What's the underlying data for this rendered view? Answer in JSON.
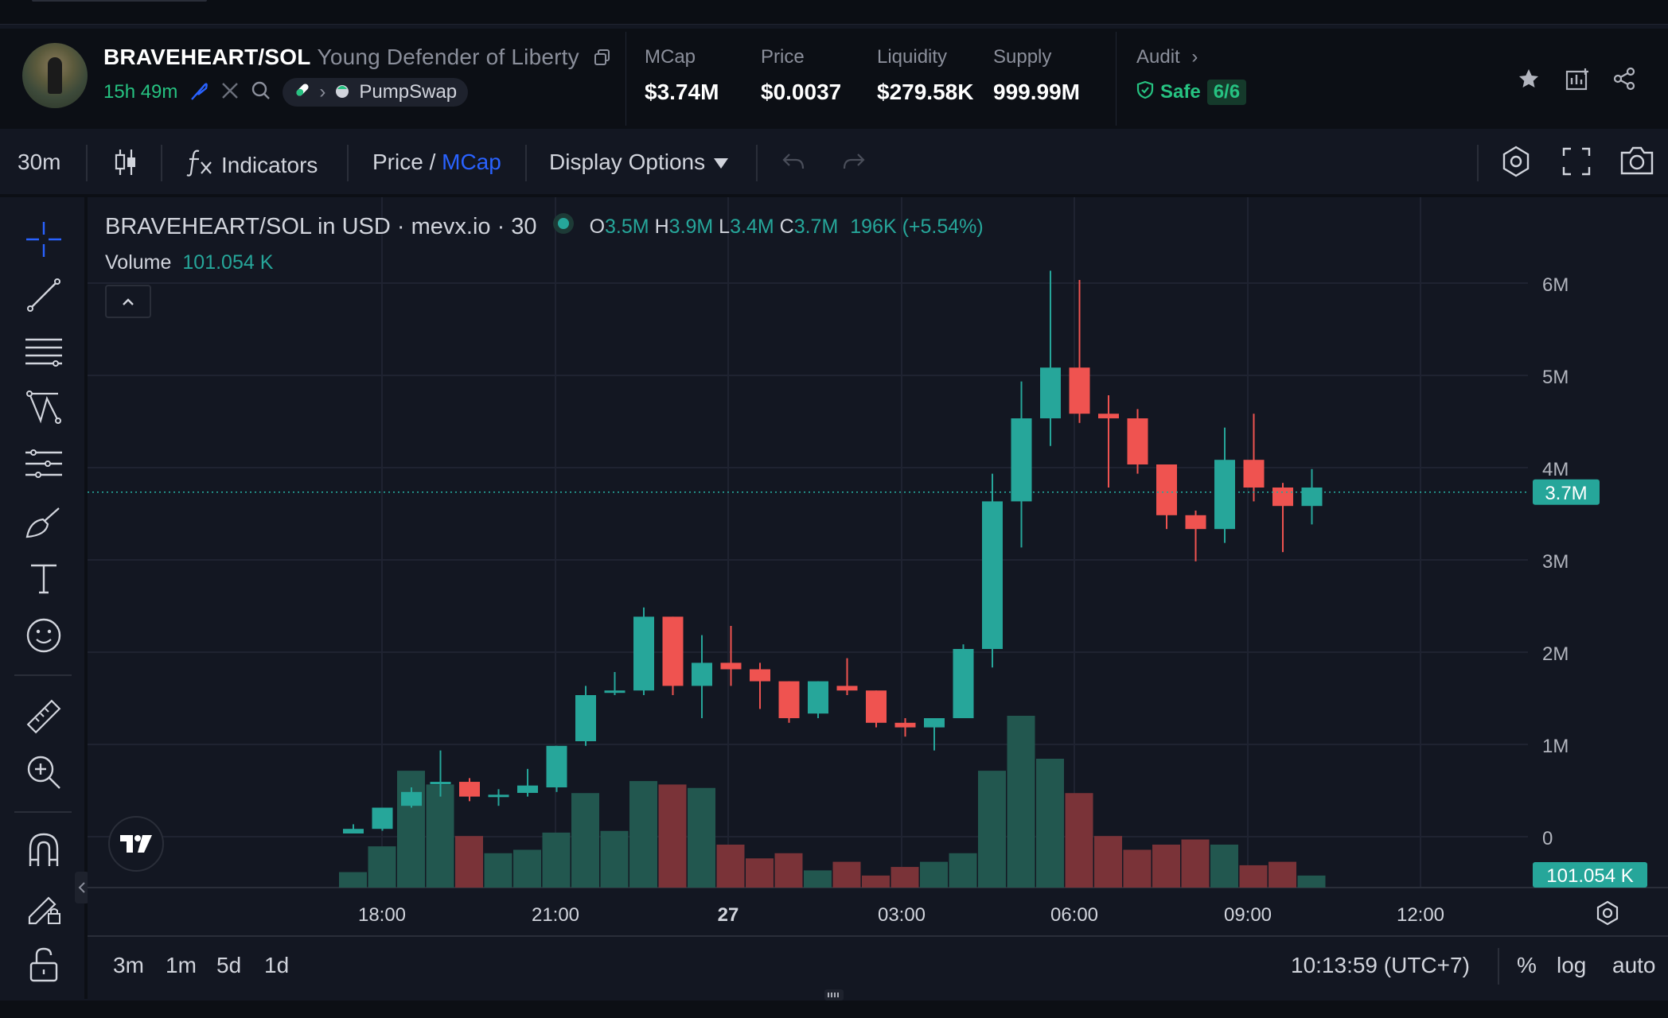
{
  "header": {
    "pair": "BRAVEHEART/SOL",
    "name": "Young Defender of Liberty",
    "age": "15h 49m",
    "dex": "PumpSwap",
    "stats": [
      {
        "label": "MCap",
        "value": "$3.74M"
      },
      {
        "label": "Price",
        "value": "$0.0037"
      },
      {
        "label": "Liquidity",
        "value": "$279.58K"
      },
      {
        "label": "Supply",
        "value": "999.99M"
      }
    ],
    "audit": {
      "label": "Audit",
      "status": "Safe",
      "score": "6/6"
    }
  },
  "toolbar": {
    "interval": "30m",
    "indicators": "Indicators",
    "price_label": "Price",
    "slash": " / ",
    "mcap_label": "MCap",
    "display_options": "Display Options"
  },
  "legend": {
    "title": "BRAVEHEART/SOL in USD · mevx.io · 30",
    "o_label": "O",
    "o": "3.5M",
    "h_label": "H",
    "h": "3.9M",
    "l_label": "L",
    "l": "3.4M",
    "c_label": "C",
    "c": "3.7M",
    "change": "196K (+5.54%)",
    "volume_label": "Volume",
    "volume_value": "101.054 K"
  },
  "chart_data": {
    "type": "candlestick",
    "price_axis_ticks": [
      "6M",
      "5M",
      "4M",
      "3M",
      "2M",
      "1M",
      "0"
    ],
    "time_axis_ticks": [
      "18:00",
      "21:00",
      "27",
      "03:00",
      "06:00",
      "09:00",
      "12:00"
    ],
    "ylim": [
      0,
      6000000
    ],
    "last_price_label": "3.7M",
    "last_price": 3700000,
    "last_volume_label": "101.054 K",
    "candles": [
      {
        "o": 0.0,
        "h": 0.1,
        "l": 0.0,
        "c": 0.05,
        "v": 0.09
      },
      {
        "o": 0.05,
        "h": 0.28,
        "l": 0.03,
        "c": 0.28,
        "v": 0.24
      },
      {
        "o": 0.3,
        "h": 0.5,
        "l": 0.28,
        "c": 0.45,
        "v": 0.68
      },
      {
        "o": 0.56,
        "h": 0.9,
        "l": 0.4,
        "c": 0.56,
        "v": 0.6
      },
      {
        "o": 0.56,
        "h": 0.6,
        "l": 0.35,
        "c": 0.4,
        "v": 0.3
      },
      {
        "o": 0.42,
        "h": 0.48,
        "l": 0.3,
        "c": 0.42,
        "v": 0.2
      },
      {
        "o": 0.44,
        "h": 0.7,
        "l": 0.4,
        "c": 0.52,
        "v": 0.22
      },
      {
        "o": 0.5,
        "h": 0.95,
        "l": 0.45,
        "c": 0.95,
        "v": 0.32
      },
      {
        "o": 1.0,
        "h": 1.6,
        "l": 0.95,
        "c": 1.5,
        "v": 0.55
      },
      {
        "o": 1.55,
        "h": 1.75,
        "l": 1.5,
        "c": 1.55,
        "v": 0.33
      },
      {
        "o": 1.55,
        "h": 2.45,
        "l": 1.5,
        "c": 2.35,
        "v": 0.62
      },
      {
        "o": 2.35,
        "h": 2.35,
        "l": 1.5,
        "c": 1.6,
        "v": 0.6
      },
      {
        "o": 1.6,
        "h": 2.15,
        "l": 1.25,
        "c": 1.85,
        "v": 0.58
      },
      {
        "o": 1.85,
        "h": 2.25,
        "l": 1.6,
        "c": 1.78,
        "v": 0.25
      },
      {
        "o": 1.78,
        "h": 1.85,
        "l": 1.35,
        "c": 1.65,
        "v": 0.17
      },
      {
        "o": 1.65,
        "h": 1.65,
        "l": 1.2,
        "c": 1.25,
        "v": 0.2
      },
      {
        "o": 1.3,
        "h": 1.65,
        "l": 1.25,
        "c": 1.65,
        "v": 0.1
      },
      {
        "o": 1.6,
        "h": 1.9,
        "l": 1.5,
        "c": 1.55,
        "v": 0.15
      },
      {
        "o": 1.55,
        "h": 1.55,
        "l": 1.15,
        "c": 1.2,
        "v": 0.07
      },
      {
        "o": 1.2,
        "h": 1.25,
        "l": 1.05,
        "c": 1.15,
        "v": 0.12
      },
      {
        "o": 1.15,
        "h": 1.25,
        "l": 0.9,
        "c": 1.25,
        "v": 0.15
      },
      {
        "o": 1.25,
        "h": 2.05,
        "l": 1.25,
        "c": 2.0,
        "v": 0.2
      },
      {
        "o": 2.0,
        "h": 3.9,
        "l": 1.8,
        "c": 3.6,
        "v": 0.68
      },
      {
        "o": 3.6,
        "h": 4.9,
        "l": 3.1,
        "c": 4.5,
        "v": 1.0
      },
      {
        "o": 4.5,
        "h": 6.1,
        "l": 4.2,
        "c": 5.05,
        "v": 0.75
      },
      {
        "o": 5.05,
        "h": 6.0,
        "l": 4.45,
        "c": 4.55,
        "v": 0.55
      },
      {
        "o": 4.55,
        "h": 4.75,
        "l": 3.75,
        "c": 4.5,
        "v": 0.3
      },
      {
        "o": 4.5,
        "h": 4.6,
        "l": 3.9,
        "c": 4.0,
        "v": 0.22
      },
      {
        "o": 4.0,
        "h": 4.0,
        "l": 3.3,
        "c": 3.45,
        "v": 0.25
      },
      {
        "o": 3.45,
        "h": 3.5,
        "l": 2.95,
        "c": 3.3,
        "v": 0.28
      },
      {
        "o": 3.3,
        "h": 4.4,
        "l": 3.15,
        "c": 4.05,
        "v": 0.25
      },
      {
        "o": 4.05,
        "h": 4.55,
        "l": 3.6,
        "c": 3.75,
        "v": 0.13
      },
      {
        "o": 3.75,
        "h": 3.8,
        "l": 3.05,
        "c": 3.55,
        "v": 0.15
      },
      {
        "o": 3.55,
        "h": 3.95,
        "l": 3.35,
        "c": 3.75,
        "v": 0.07
      }
    ]
  },
  "bottom": {
    "ranges": [
      "3m",
      "1m",
      "5d",
      "1d"
    ],
    "clock": "10:13:59 (UTC+7)",
    "percent": "%",
    "log": "log",
    "auto": "auto"
  },
  "colors": {
    "up": "#26a69a",
    "down": "#ef5350",
    "up_vol": "#22574f",
    "down_vol": "#7a3338",
    "accent": "#2962ff"
  },
  "icons": [
    "copy-icon",
    "pen-feather-icon",
    "x-logo-icon",
    "search-icon",
    "pill-icon",
    "chevron-right-icon",
    "pumpswap-icon",
    "shield-check-icon",
    "star-icon",
    "chart-add-icon",
    "share-icon",
    "candles-icon",
    "fx-icon",
    "undo-icon",
    "redo-icon",
    "settings-hex-icon",
    "fullscreen-icon",
    "camera-icon"
  ]
}
